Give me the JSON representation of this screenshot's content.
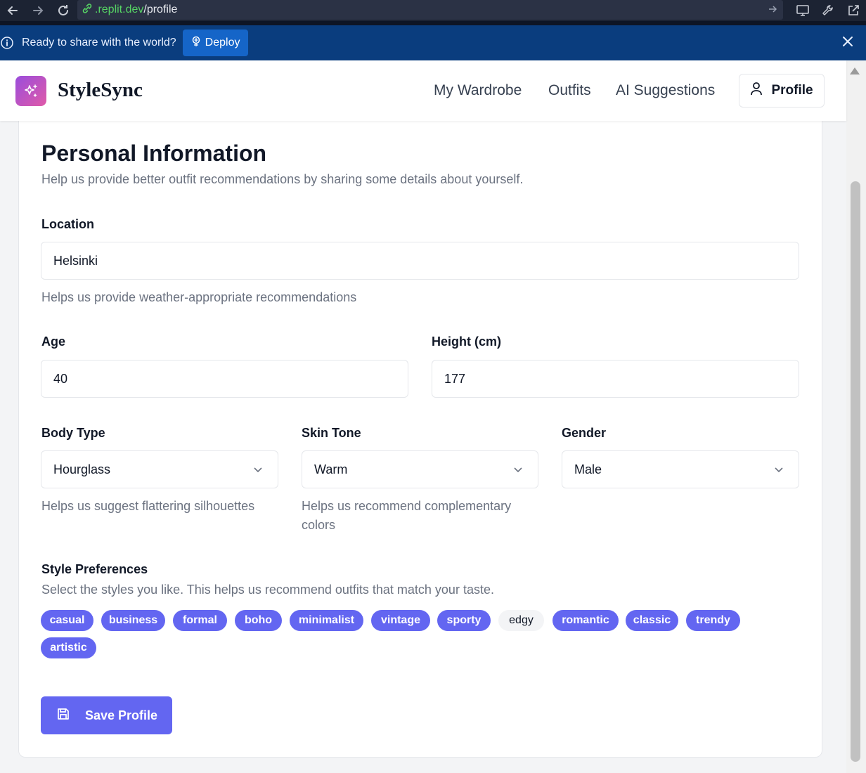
{
  "browser": {
    "url_host": ".replit.dev",
    "url_path": "/profile"
  },
  "banner": {
    "text": "Ready to share with the world?",
    "deploy_label": "Deploy"
  },
  "header": {
    "brand": "StyleSync",
    "nav": [
      "My Wardrobe",
      "Outfits",
      "AI Suggestions"
    ],
    "profile_label": "Profile"
  },
  "form": {
    "title": "Personal Information",
    "description": "Help us provide better outfit recommendations by sharing some details about yourself.",
    "location": {
      "label": "Location",
      "value": "Helsinki",
      "help": "Helps us provide weather-appropriate recommendations"
    },
    "age": {
      "label": "Age",
      "value": "40"
    },
    "height": {
      "label": "Height (cm)",
      "value": "177"
    },
    "body_type": {
      "label": "Body Type",
      "value": "Hourglass",
      "help": "Helps us suggest flattering silhouettes"
    },
    "skin_tone": {
      "label": "Skin Tone",
      "value": "Warm",
      "help": "Helps us recommend complementary colors"
    },
    "gender": {
      "label": "Gender",
      "value": "Male"
    },
    "style_prefs": {
      "label": "Style Preferences",
      "description": "Select the styles you like. This helps us recommend outfits that match your taste.",
      "tags": [
        {
          "label": "casual",
          "selected": true
        },
        {
          "label": "business",
          "selected": true
        },
        {
          "label": "formal",
          "selected": true
        },
        {
          "label": "boho",
          "selected": true
        },
        {
          "label": "minimalist",
          "selected": true
        },
        {
          "label": "vintage",
          "selected": true
        },
        {
          "label": "sporty",
          "selected": true
        },
        {
          "label": "edgy",
          "selected": false
        },
        {
          "label": "romantic",
          "selected": true
        },
        {
          "label": "classic",
          "selected": true
        },
        {
          "label": "trendy",
          "selected": true
        },
        {
          "label": "artistic",
          "selected": true
        }
      ]
    },
    "save_label": "Save Profile"
  },
  "colors": {
    "accent": "#6366f1",
    "banner": "#0a3d7e",
    "deploy": "#1565c8",
    "chrome": "#1c2333"
  },
  "icons": [
    "back-arrow-icon",
    "forward-arrow-icon",
    "reload-icon",
    "link-icon",
    "info-icon",
    "deploy-icon",
    "close-icon",
    "sparkle-icon",
    "user-icon",
    "chevron-down-icon",
    "save-icon",
    "monitor-icon",
    "wrench-icon",
    "external-link-icon"
  ]
}
